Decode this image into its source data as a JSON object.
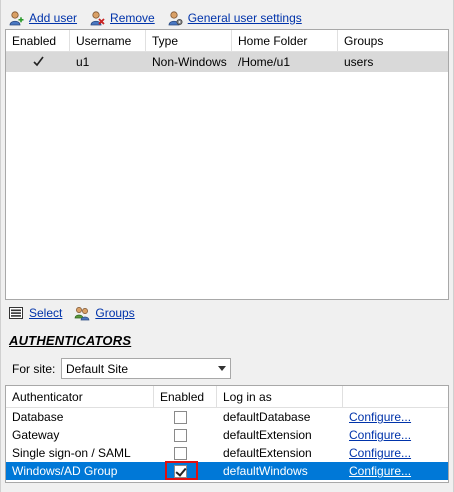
{
  "toolbar": {
    "add_user": "Add user",
    "remove": "Remove",
    "general_settings": "General user settings"
  },
  "users_table": {
    "columns": [
      "Enabled",
      "Username",
      "Type",
      "Home Folder",
      "Groups"
    ],
    "rows": [
      {
        "enabled": true,
        "username": "u1",
        "type": "Non-Windows",
        "home_folder": "/Home/u1",
        "groups": "users"
      }
    ]
  },
  "lower_links": {
    "select": "Select",
    "groups": "Groups"
  },
  "authenticators": {
    "title": "AUTHENTICATORS",
    "site_label": "For site:",
    "site_value": "Default Site",
    "columns": [
      "Authenticator",
      "Enabled",
      "Log in as",
      ""
    ],
    "rows": [
      {
        "name": "Database",
        "enabled": false,
        "login_as": "defaultDatabase",
        "action": "Configure..."
      },
      {
        "name": "Gateway",
        "enabled": false,
        "login_as": "defaultExtension",
        "action": "Configure..."
      },
      {
        "name": "Single sign-on / SAML",
        "enabled": false,
        "login_as": "defaultExtension",
        "action": "Configure..."
      },
      {
        "name": "Windows/AD Group",
        "enabled": true,
        "login_as": "defaultWindows",
        "action": "Configure..."
      }
    ],
    "selected_row": 3
  },
  "colors": {
    "selection": "#0078d7",
    "link": "#0033aa",
    "highlight_box": "#e01010"
  },
  "icons": [
    "add-user-icon",
    "remove-user-icon",
    "user-settings-icon",
    "select-list-icon",
    "groups-icon"
  ]
}
